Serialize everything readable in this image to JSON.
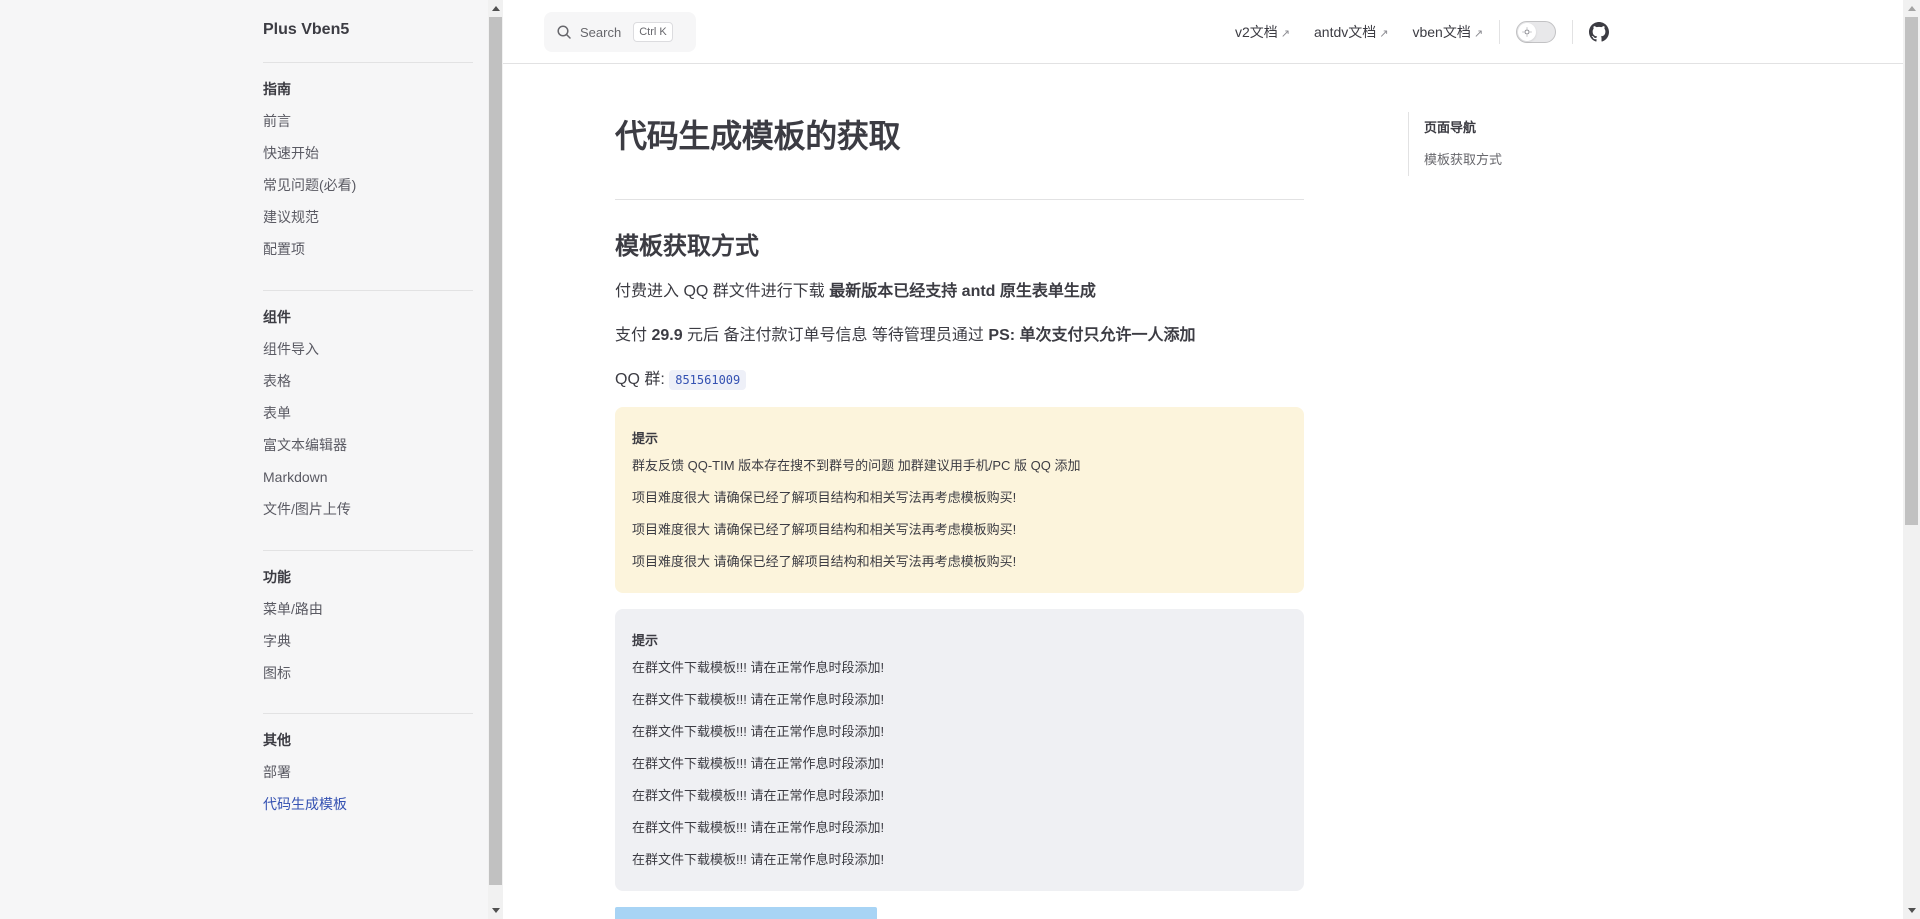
{
  "sidebar": {
    "site_title": "Plus Vben5",
    "groups": [
      {
        "title": "指南",
        "items": [
          "前言",
          "快速开始",
          "常见问题(必看)",
          "建议规范",
          "配置项"
        ]
      },
      {
        "title": "组件",
        "items": [
          "组件导入",
          "表格",
          "表单",
          "富文本编辑器",
          "Markdown",
          "文件/图片上传"
        ]
      },
      {
        "title": "功能",
        "items": [
          "菜单/路由",
          "字典",
          "图标"
        ]
      },
      {
        "title": "其他",
        "items": [
          "部署",
          "代码生成模板"
        ]
      }
    ],
    "active_item": "代码生成模板"
  },
  "navbar": {
    "search_label": "Search",
    "search_kbd": "Ctrl K",
    "links": [
      {
        "label": "v2文档",
        "external": "↗"
      },
      {
        "label": "antdv文档",
        "external": "↗"
      },
      {
        "label": "vben文档",
        "external": "↗"
      }
    ],
    "icons": {
      "search": "search-icon",
      "theme": "sun-icon",
      "github": "github-icon"
    }
  },
  "main": {
    "title": "代码生成模板的获取",
    "section_title": "模板获取方式",
    "p1": {
      "text": "付费进入 QQ 群文件进行下载 ",
      "bold": "最新版本已经支持 antd 原生表单生成"
    },
    "p2": {
      "t1": "支付 ",
      "b1": "29.9",
      "t2": " 元后 备注付款订单号信息 等待管理员通过 ",
      "b2": "PS: 单次支付只允许一人添加"
    },
    "p3": {
      "label": "QQ 群: ",
      "code": "851561009"
    },
    "tip_warning": {
      "title": "提示",
      "lines": [
        "群友反馈 QQ-TIM 版本存在搜不到群号的问题 加群建议用手机/PC 版 QQ 添加",
        "项目难度很大 请确保已经了解项目结构和相关写法再考虑模板购买!",
        "项目难度很大 请确保已经了解项目结构和相关写法再考虑模板购买!",
        "项目难度很大 请确保已经了解项目结构和相关写法再考虑模板购买!"
      ]
    },
    "tip_info": {
      "title": "提示",
      "lines": [
        "在群文件下载模板!!! 请在正常作息时段添加!",
        "在群文件下载模板!!! 请在正常作息时段添加!",
        "在群文件下载模板!!! 请在正常作息时段添加!",
        "在群文件下载模板!!! 请在正常作息时段添加!",
        "在群文件下载模板!!! 请在正常作息时段添加!",
        "在群文件下载模板!!! 请在正常作息时段添加!",
        "在群文件下载模板!!! 请在正常作息时段添加!"
      ]
    }
  },
  "outline": {
    "title": "页面导航",
    "items": [
      "模板获取方式"
    ]
  },
  "colors": {
    "brand": "#3451b2",
    "warning_bg": "#fcf4dc",
    "info_bg": "#eff0f3"
  }
}
